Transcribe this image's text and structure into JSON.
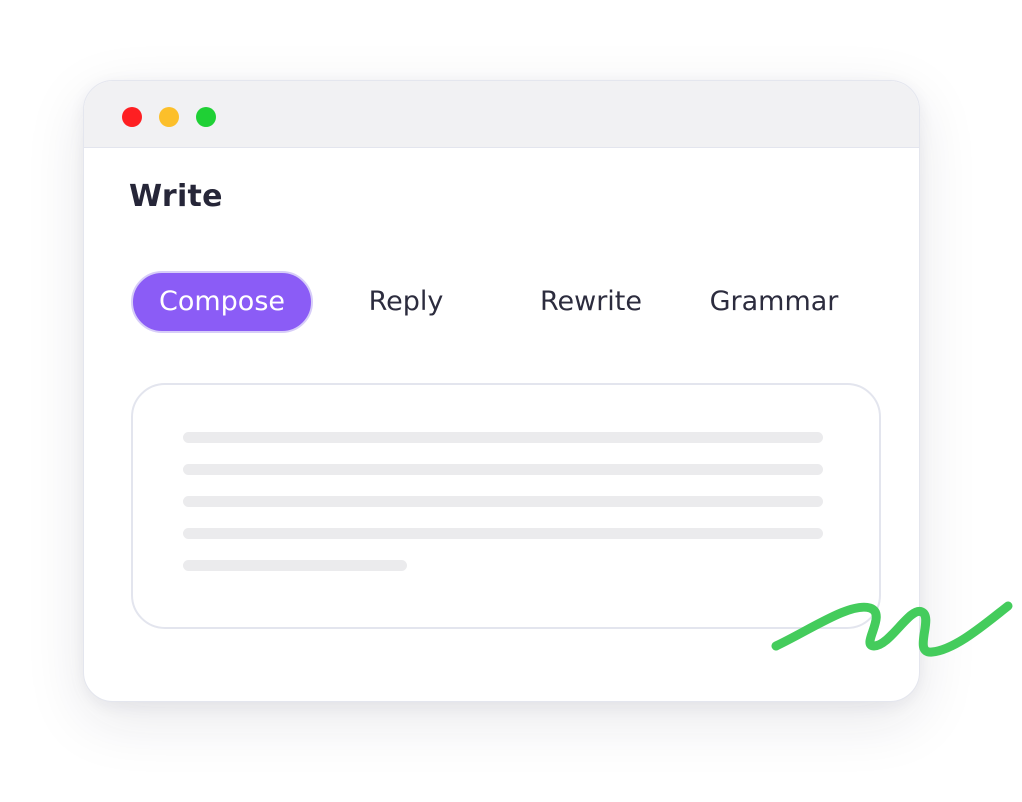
{
  "window": {
    "controls": [
      "close",
      "minimize",
      "maximize"
    ],
    "colors": {
      "close": "#fe1f22",
      "minimize": "#fcbf2a",
      "maximize": "#1fd035"
    }
  },
  "main": {
    "title": "Write",
    "tabs": [
      {
        "label": "Compose",
        "active": true
      },
      {
        "label": "Reply",
        "active": false
      },
      {
        "label": "Rewrite",
        "active": false
      },
      {
        "label": "Grammar",
        "active": false
      }
    ],
    "editor": {
      "placeholder_lines": 5
    }
  },
  "colors": {
    "accent": "#8b5cf6",
    "squiggle": "#44cc5c"
  },
  "decoration": {
    "icon": "green-squiggle-icon"
  }
}
